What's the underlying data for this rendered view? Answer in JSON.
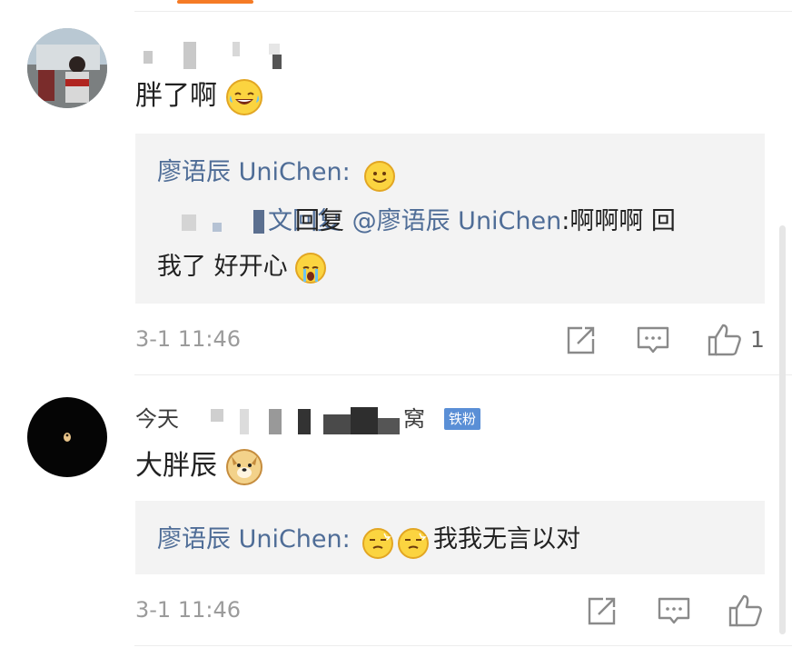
{
  "comments": [
    {
      "content": "胖了啊",
      "reply": {
        "author": "廖语辰 UniChen:",
        "nested_tail": "文回复",
        "mention": "@廖语辰 UniChen",
        "nested_text_line1": ":啊啊啊 回",
        "nested_text_line2": "我了 好开心"
      },
      "timestamp": "3-1 11:46",
      "like_count": "1"
    },
    {
      "user_prefix": "今天",
      "user_suffix": "窝",
      "badge": "铁粉",
      "content": "大胖辰",
      "reply": {
        "author": "廖语辰 UniChen:",
        "text": "我我无言以对"
      },
      "timestamp": "3-1 11:46"
    }
  ],
  "icons": {
    "laugh_emoji": "laugh-cry-emoji",
    "smile_emoji": "smile-emoji",
    "cry_emoji": "cry-emoji",
    "doge_emoji": "doge-emoji",
    "dizzy_emoji": "dizzy-emoji",
    "share": "share-icon",
    "comment": "comment-icon",
    "like": "thumbs-up-icon"
  },
  "colors": {
    "link": "#4f6d97",
    "accent": "#f57b25",
    "badge": "#5a8fd6",
    "quote_bg": "#f3f3f3"
  }
}
